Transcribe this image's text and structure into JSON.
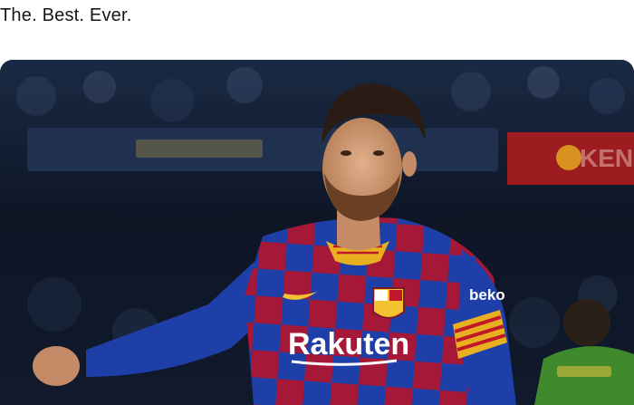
{
  "tweet": {
    "text": "The. Best. Ever."
  },
  "photo": {
    "jersey_sponsor": "Rakuten",
    "sleeve_sponsor": "beko",
    "board_right_text": "KEN"
  },
  "colors": {
    "jersey_blue": "#1f3fa8",
    "jersey_red": "#a51838",
    "stadium_dark": "#0c1422",
    "teammate_green": "#3f8a2c"
  }
}
